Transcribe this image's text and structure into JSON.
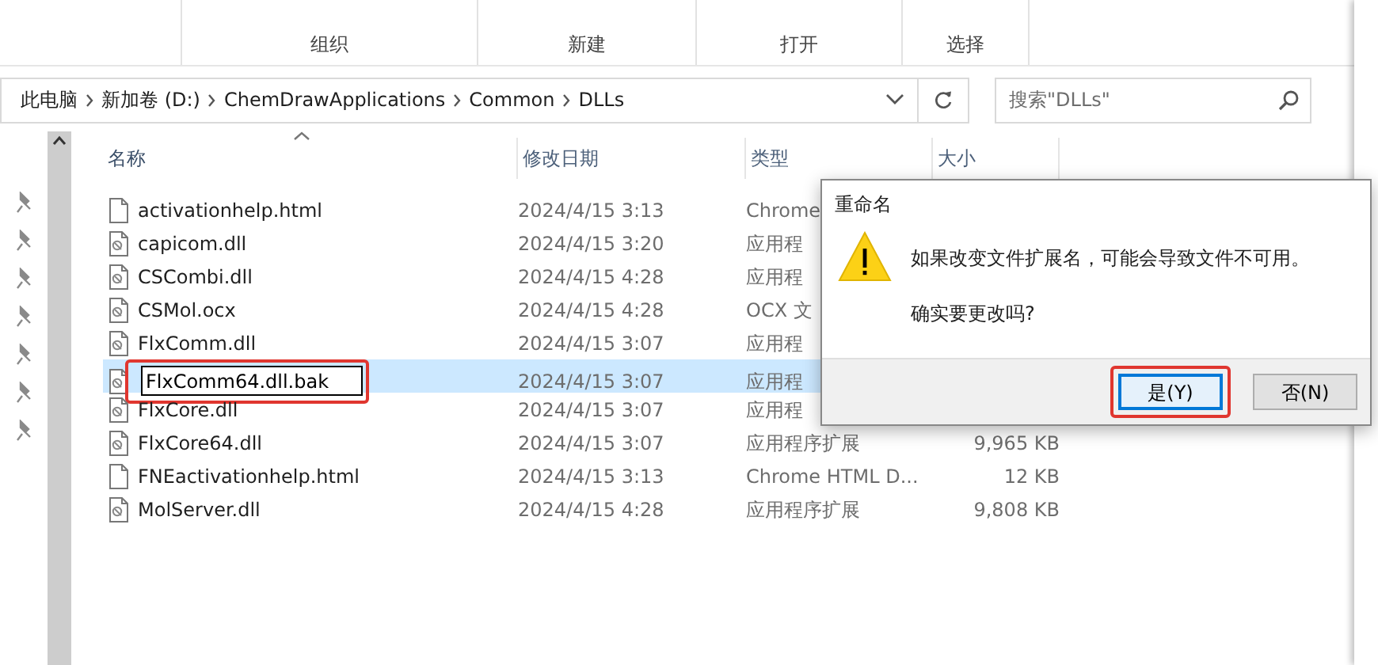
{
  "ribbon": {
    "groups": [
      "组织",
      "新建",
      "打开",
      "选择"
    ]
  },
  "address": {
    "crumbs": [
      "此电脑",
      "新加卷 (D:)",
      "ChemDrawApplications",
      "Common",
      "DLLs"
    ],
    "search_placeholder": "搜索\"DLLs\""
  },
  "columns": [
    {
      "label": "名称",
      "sorted": true
    },
    {
      "label": "修改日期",
      "sorted": false
    },
    {
      "label": "类型",
      "sorted": false
    },
    {
      "label": "大小",
      "sorted": false
    }
  ],
  "files": [
    {
      "name": "activationhelp.html",
      "kind": "html",
      "date": "2024/4/15 3:13",
      "type": "Chrome",
      "selected": false,
      "renaming": false
    },
    {
      "name": "capicom.dll",
      "kind": "dll",
      "date": "2024/4/15 3:20",
      "type": "应用程",
      "selected": false,
      "renaming": false
    },
    {
      "name": "CSCombi.dll",
      "kind": "dll",
      "date": "2024/4/15 4:28",
      "type": "应用程",
      "selected": false,
      "renaming": false
    },
    {
      "name": "CSMol.ocx",
      "kind": "dll",
      "date": "2024/4/15 4:28",
      "type": "OCX 文",
      "selected": false,
      "renaming": false
    },
    {
      "name": "FlxComm.dll",
      "kind": "dll",
      "date": "2024/4/15 3:07",
      "type": "应用程",
      "selected": false,
      "renaming": false
    },
    {
      "name": "FlxComm64.dll.bak",
      "kind": "dll",
      "date": "2024/4/15 3:07",
      "type": "应用程",
      "selected": true,
      "renaming": true,
      "highlighted": true
    },
    {
      "name": "FlxCore.dll",
      "kind": "dll",
      "date": "2024/4/15 3:07",
      "type": "应用程",
      "selected": false,
      "renaming": false
    },
    {
      "name": "FlxCore64.dll",
      "kind": "dll",
      "date": "2024/4/15 3:07",
      "type": "应用程序扩展",
      "size": "9,965 KB",
      "selected": false,
      "renaming": false
    },
    {
      "name": "FNEactivationhelp.html",
      "kind": "html",
      "date": "2024/4/15 3:13",
      "type": "Chrome HTML D...",
      "size": "12 KB",
      "selected": false,
      "renaming": false
    },
    {
      "name": "MolServer.dll",
      "kind": "dll",
      "date": "2024/4/15 4:28",
      "type": "应用程序扩展",
      "size": "9,808 KB",
      "selected": false,
      "renaming": false
    }
  ],
  "dialog": {
    "title": "重命名",
    "message": "如果改变文件扩展名，可能会导致文件不可用。",
    "question": "确实要更改吗?",
    "buttons": [
      {
        "label": "是(Y)",
        "focused": true,
        "highlighted": true
      },
      {
        "label": "否(N)",
        "focused": false,
        "highlighted": false
      }
    ]
  }
}
